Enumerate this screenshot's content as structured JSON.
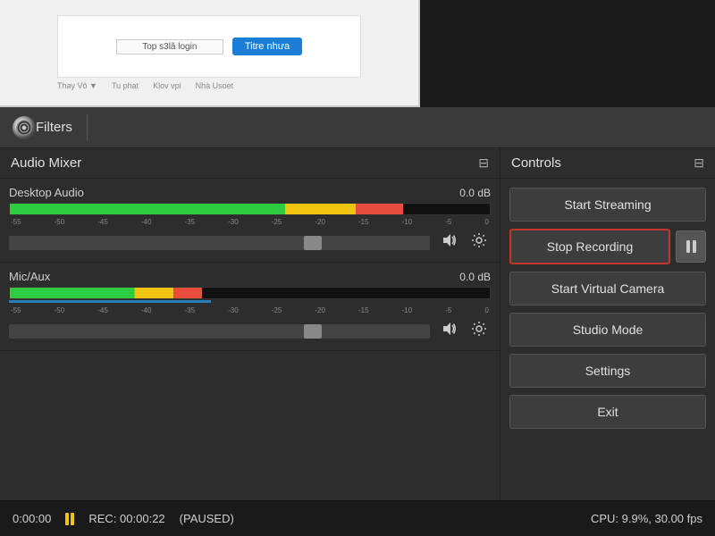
{
  "overlay": {
    "text_field_label": "Top s3lã login",
    "blue_button_label": "Titre nhưa",
    "bottom_items": [
      "Thay Vô ▼",
      "Tu phat",
      "Klov vpi",
      "Nhà Usoet"
    ]
  },
  "top_bar": {
    "filters_label": "Filters"
  },
  "audio_mixer": {
    "title": "Audio Mixer",
    "icon": "⊟",
    "channels": [
      {
        "name": "Desktop Audio",
        "db": "0.0 dB",
        "vu_labels": [
          "-55",
          "-50",
          "-45",
          "-40",
          "-35",
          "-30",
          "-25",
          "-20",
          "-15",
          "-10",
          "-5",
          "0"
        ]
      },
      {
        "name": "Mic/Aux",
        "db": "0.0 dB",
        "vu_labels": [
          "-55",
          "-50",
          "-45",
          "-40",
          "-35",
          "-30",
          "-25",
          "-20",
          "-15",
          "-10",
          "-5",
          "0"
        ]
      }
    ]
  },
  "controls": {
    "title": "Controls",
    "icon": "⊟",
    "buttons": {
      "start_streaming": "Start Streaming",
      "stop_recording": "Stop Recording",
      "start_virtual_camera": "Start Virtual Camera",
      "studio_mode": "Studio Mode",
      "settings": "Settings",
      "exit": "Exit"
    },
    "pause_icon_title": "Pause"
  },
  "status_bar": {
    "time": "0:00:00",
    "rec_label": "REC: 00:00:22",
    "paused_label": "(PAUSED)",
    "cpu_label": "CPU: 9.9%, 30.00 fps"
  }
}
